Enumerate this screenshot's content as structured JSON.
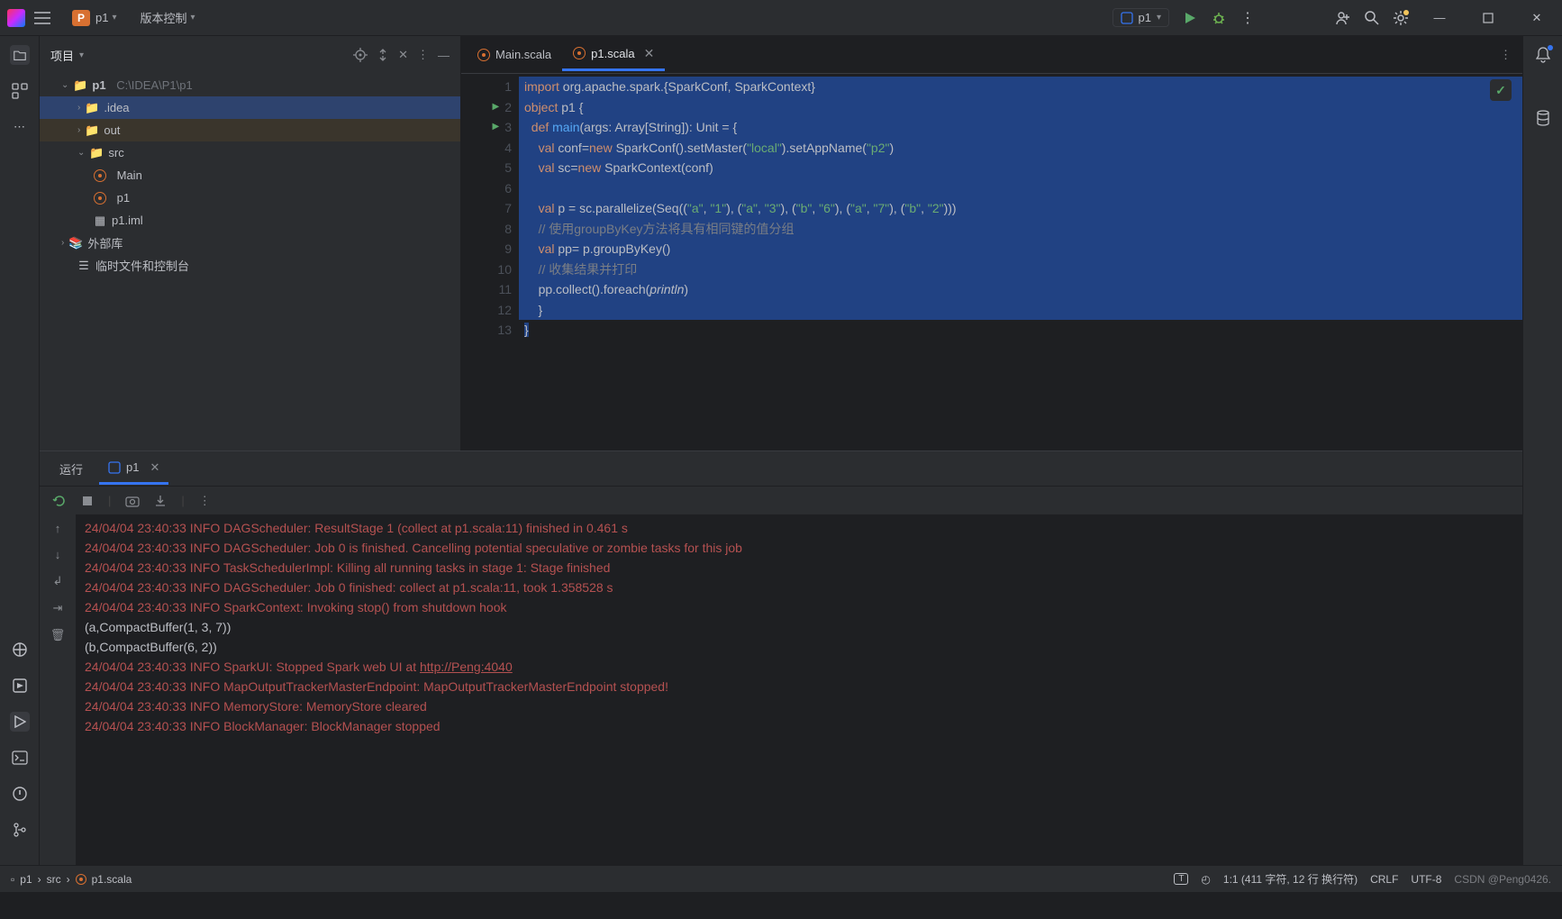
{
  "titlebar": {
    "project_badge": "P",
    "project_name": "p1",
    "vcs": "版本控制",
    "run_config": "p1"
  },
  "toolwindow": {
    "project_label": "项目"
  },
  "tree": {
    "root": "p1",
    "root_path": "C:\\IDEA\\P1\\p1",
    "idea": ".idea",
    "out": "out",
    "src": "src",
    "main": "Main",
    "p1file": "p1",
    "iml": "p1.iml",
    "ext": "外部库",
    "scratch": "临时文件和控制台"
  },
  "editor": {
    "tab_main": "Main.scala",
    "tab_p1": "p1.scala"
  },
  "code": {
    "l1_kw": "import",
    "l1_rest": " org.apache.spark.{SparkConf, SparkContext}",
    "l2_kw": "object",
    "l2_rest": " p1 {",
    "l3_pre": "  ",
    "l3_kw": "def ",
    "l3_fn": "main",
    "l3_rest": "(args: Array[String]): Unit = {",
    "l4_pre": "    ",
    "l4_kw": "val",
    "l4_a": " conf=",
    "l4_kw2": "new",
    "l4_b": " SparkConf().setMaster(",
    "l4_s1": "\"local\"",
    "l4_c": ").setAppName(",
    "l4_s2": "\"p2\"",
    "l4_d": ")",
    "l5_pre": "    ",
    "l5_kw": "val",
    "l5_a": " sc=",
    "l5_kw2": "new",
    "l5_b": " SparkContext(conf)",
    "l7_pre": "    ",
    "l7_kw": "val",
    "l7_a": " p = sc.parallelize(Seq((",
    "l7_s1": "\"a\"",
    "l7_c1": ", ",
    "l7_s2": "\"1\"",
    "l7_c2": "), (",
    "l7_s3": "\"a\"",
    "l7_c3": ", ",
    "l7_s4": "\"3\"",
    "l7_c4": "), (",
    "l7_s5": "\"b\"",
    "l7_c5": ", ",
    "l7_s6": "\"6\"",
    "l7_c6": "), (",
    "l7_s7": "\"a\"",
    "l7_c7": ", ",
    "l7_s8": "\"7\"",
    "l7_c8": "), (",
    "l7_s9": "\"b\"",
    "l7_c9": ", ",
    "l7_s10": "\"2\"",
    "l7_c10": ")))",
    "l8_pre": "    ",
    "l8_com": "// 使用groupByKey方法将具有相同键的值分组",
    "l9_pre": "    ",
    "l9_kw": "val",
    "l9_a": " pp= p.groupByKey()",
    "l10_pre": "    ",
    "l10_com": "// 收集结果并打印",
    "l11_pre": "    ",
    "l11_a": "pp.collect().foreach(",
    "l11_it": "println",
    "l11_b": ")",
    "l12": "    }",
    "l13": "}"
  },
  "run": {
    "tab_run": "运行",
    "tab_cfg": "p1"
  },
  "console": [
    {
      "t": "r",
      "v": "24/04/04 23:40:33 INFO DAGScheduler: ResultStage 1 (collect at p1.scala:11) finished in 0.461 s"
    },
    {
      "t": "r",
      "v": "24/04/04 23:40:33 INFO DAGScheduler: Job 0 is finished. Cancelling potential speculative or zombie tasks for this job"
    },
    {
      "t": "r",
      "v": "24/04/04 23:40:33 INFO TaskSchedulerImpl: Killing all running tasks in stage 1: Stage finished"
    },
    {
      "t": "r",
      "v": "24/04/04 23:40:33 INFO DAGScheduler: Job 0 finished: collect at p1.scala:11, took 1.358528 s"
    },
    {
      "t": "r",
      "v": "24/04/04 23:40:33 INFO SparkContext: Invoking stop() from shutdown hook"
    },
    {
      "t": "w",
      "v": "(a,CompactBuffer(1, 3, 7))"
    },
    {
      "t": "w",
      "v": "(b,CompactBuffer(6, 2))"
    },
    {
      "t": "rl",
      "v": "24/04/04 23:40:33 INFO SparkUI: Stopped Spark web UI at ",
      "url": "http://Peng:4040"
    },
    {
      "t": "r",
      "v": "24/04/04 23:40:33 INFO MapOutputTrackerMasterEndpoint: MapOutputTrackerMasterEndpoint stopped!"
    },
    {
      "t": "r",
      "v": "24/04/04 23:40:33 INFO MemoryStore: MemoryStore cleared"
    },
    {
      "t": "r",
      "v": "24/04/04 23:40:33 INFO BlockManager: BlockManager stopped"
    }
  ],
  "status": {
    "b1": "p1",
    "b2": "src",
    "b3": "p1.scala",
    "t": "T",
    "pos": "1:1 (411 字符, 12 行 换行符)",
    "crlf": "CRLF",
    "enc": "UTF-8",
    "wm": "CSDN @Peng0426."
  }
}
